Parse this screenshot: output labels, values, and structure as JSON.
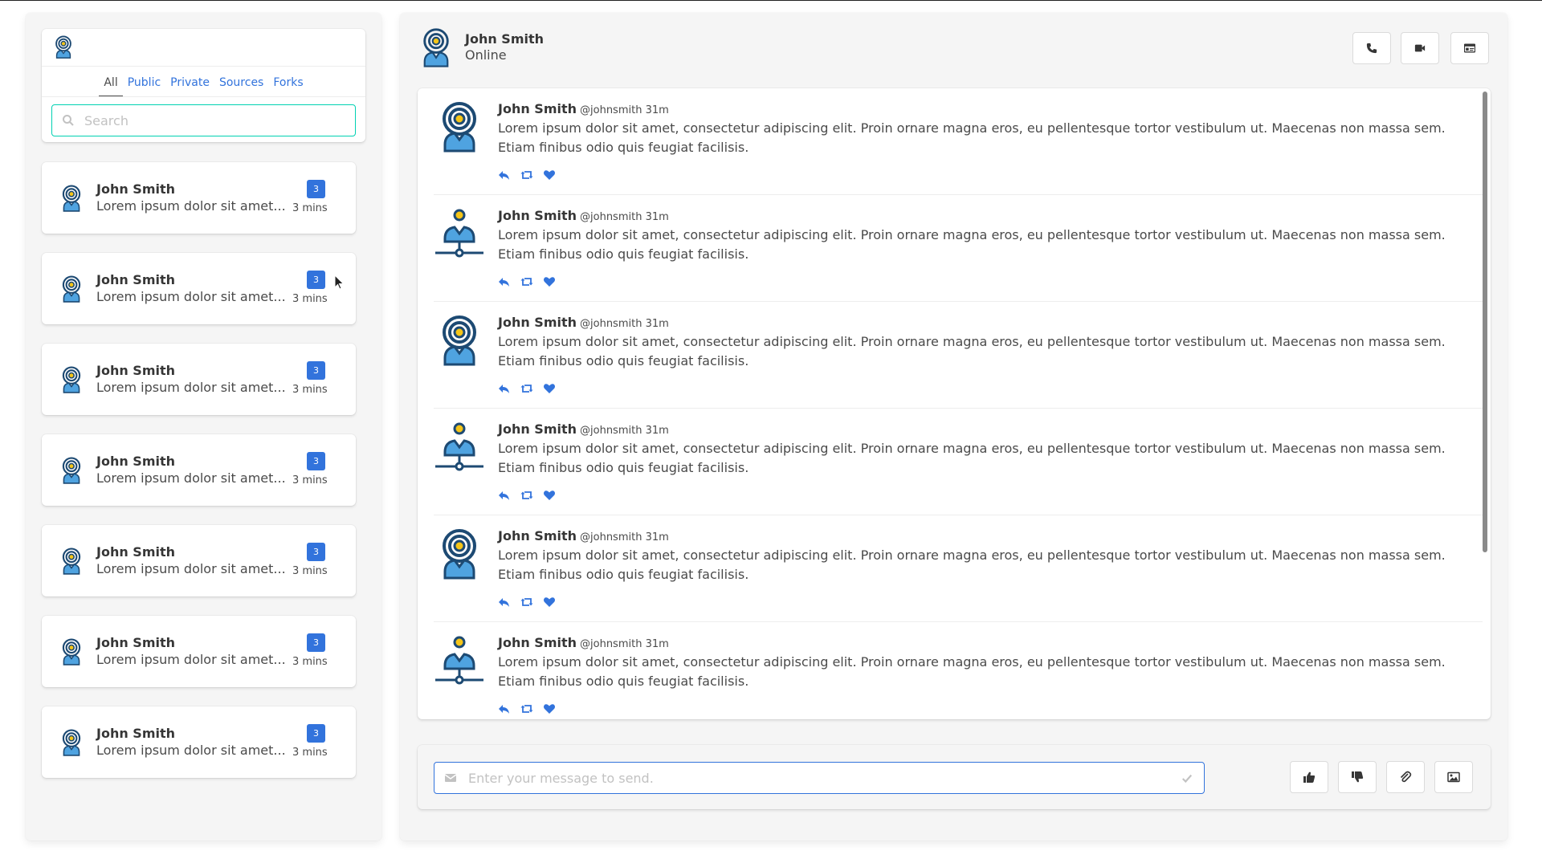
{
  "colors": {
    "accent": "#3273dc",
    "search_border": "#00d1b2",
    "badge": "#3273dc",
    "avatar_dark": "#1d4a73",
    "avatar_yellow": "#f5c518",
    "avatar_blue": "#4fa3e0"
  },
  "sidebar": {
    "logo_icon": "radar-person-icon",
    "tabs": [
      "All",
      "Public",
      "Private",
      "Sources",
      "Forks"
    ],
    "active_tab": "All",
    "search": {
      "placeholder": "Search",
      "value": ""
    },
    "contacts": [
      {
        "name": "John Smith",
        "preview": "Lorem ipsum dolor sit amet...",
        "badge": "3",
        "time": "3 mins"
      },
      {
        "name": "John Smith",
        "preview": "Lorem ipsum dolor sit amet...",
        "badge": "3",
        "time": "3 mins"
      },
      {
        "name": "John Smith",
        "preview": "Lorem ipsum dolor sit amet...",
        "badge": "3",
        "time": "3 mins"
      },
      {
        "name": "John Smith",
        "preview": "Lorem ipsum dolor sit amet...",
        "badge": "3",
        "time": "3 mins"
      },
      {
        "name": "John Smith",
        "preview": "Lorem ipsum dolor sit amet...",
        "badge": "3",
        "time": "3 mins"
      },
      {
        "name": "John Smith",
        "preview": "Lorem ipsum dolor sit amet...",
        "badge": "3",
        "time": "3 mins"
      },
      {
        "name": "John Smith",
        "preview": "Lorem ipsum dolor sit amet...",
        "badge": "3",
        "time": "3 mins"
      }
    ]
  },
  "chat": {
    "header": {
      "name": "John Smith",
      "status": "Online",
      "buttons": [
        "phone-icon",
        "video-camera-icon",
        "id-card-icon"
      ]
    },
    "posts": [
      {
        "name": "John Smith",
        "handle": "@johnsmith 31m",
        "avatar": "radar-person-icon",
        "text": "Lorem ipsum dolor sit amet, consectetur adipiscing elit. Proin ornare magna eros, eu pellentesque tortor vestibulum ut. Maecenas non massa sem. Etiam finibus odio quis feugiat facilisis."
      },
      {
        "name": "John Smith",
        "handle": "@johnsmith 31m",
        "avatar": "network-person-icon",
        "text": "Lorem ipsum dolor sit amet, consectetur adipiscing elit. Proin ornare magna eros, eu pellentesque tortor vestibulum ut. Maecenas non massa sem. Etiam finibus odio quis feugiat facilisis."
      },
      {
        "name": "John Smith",
        "handle": "@johnsmith 31m",
        "avatar": "radar-person-icon",
        "text": "Lorem ipsum dolor sit amet, consectetur adipiscing elit. Proin ornare magna eros, eu pellentesque tortor vestibulum ut. Maecenas non massa sem. Etiam finibus odio quis feugiat facilisis."
      },
      {
        "name": "John Smith",
        "handle": "@johnsmith 31m",
        "avatar": "network-person-icon",
        "text": "Lorem ipsum dolor sit amet, consectetur adipiscing elit. Proin ornare magna eros, eu pellentesque tortor vestibulum ut. Maecenas non massa sem. Etiam finibus odio quis feugiat facilisis."
      },
      {
        "name": "John Smith",
        "handle": "@johnsmith 31m",
        "avatar": "radar-person-icon",
        "text": "Lorem ipsum dolor sit amet, consectetur adipiscing elit. Proin ornare magna eros, eu pellentesque tortor vestibulum ut. Maecenas non massa sem. Etiam finibus odio quis feugiat facilisis."
      },
      {
        "name": "John Smith",
        "handle": "@johnsmith 31m",
        "avatar": "network-person-icon",
        "text": "Lorem ipsum dolor sit amet, consectetur adipiscing elit. Proin ornare magna eros, eu pellentesque tortor vestibulum ut. Maecenas non massa sem. Etiam finibus odio quis feugiat facilisis."
      }
    ],
    "post_actions": [
      "reply-icon",
      "retweet-icon",
      "heart-icon"
    ],
    "composer": {
      "placeholder": "Enter your message to send.",
      "value": "",
      "buttons": [
        "thumbs-up-icon",
        "thumbs-down-icon",
        "paperclip-icon",
        "image-icon"
      ]
    }
  }
}
